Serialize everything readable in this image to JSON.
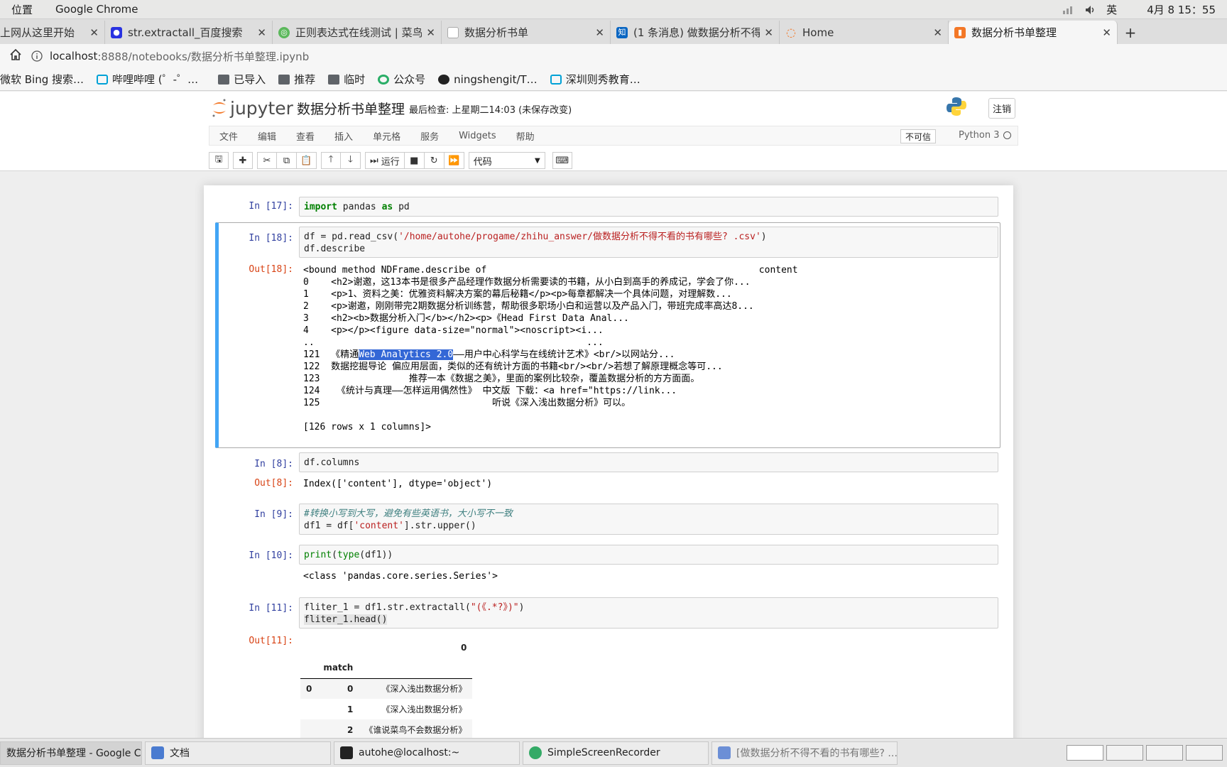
{
  "system": {
    "menu_places": "位置",
    "menu_app": "Google Chrome",
    "ime": "英",
    "clock": "4月 8 15：55"
  },
  "tabs": [
    {
      "title": "上网从这里开始"
    },
    {
      "title": "str.extractall_百度搜索"
    },
    {
      "title": "正则表达式在线测试 | 菜鸟"
    },
    {
      "title": "数据分析书单"
    },
    {
      "title": "(1 条消息) 做数据分析不得"
    },
    {
      "title": "Home"
    },
    {
      "title": "数据分析书单整理"
    }
  ],
  "address": {
    "host": "localhost",
    "path": ":8888/notebooks/数据分析书单整理.ipynb"
  },
  "bookmarks": [
    {
      "label": "微软 Bing 搜索…"
    },
    {
      "label": "哔哩哔哩 (゜-゜…"
    },
    {
      "label": "已导入"
    },
    {
      "label": "推荐"
    },
    {
      "label": "临时"
    },
    {
      "label": "公众号"
    },
    {
      "label": "ningshengit/T…"
    },
    {
      "label": "深圳则秀教育…"
    }
  ],
  "jupyter": {
    "logo_text": "jupyter",
    "notebook_name": "数据分析书单整理",
    "checkpoint": "最后检查: 上星期二14:03   (未保存改变)",
    "logout": "注销",
    "menus": [
      "文件",
      "编辑",
      "查看",
      "插入",
      "单元格",
      "服务",
      "Widgets",
      "帮助"
    ],
    "trust": "不可信",
    "kernel": "Python 3",
    "run_label": "运行",
    "cell_type": "代码"
  },
  "cells": {
    "c17": {
      "prompt": "In [17]:"
    },
    "c18": {
      "prompt": "In [18]:",
      "out_prompt": "Out[18]:",
      "out_lines": [
        "<bound method NDFrame.describe of                                                 content",
        "0    <h2>谢邀，这13本书是很多产品经理作数据分析需要读的书籍，从小白到高手的养成记，学会了你...",
        "1    <p>1、资料之美：优雅资料解决方案的幕后秘籍</p><p>每章都解决一个具体问题，对理解数...",
        "2    <p>谢邀，刚刚带完2期数据分析训练营，帮助很多职场小白和运营以及产品入门，带班完成率高达8...",
        "3    <h2><b>数据分析入门</b></h2><p>《Head First Data Anal...",
        "4    <p></p><figure data-size=\"normal\"><noscript><i...",
        "..                                                 ..."
      ],
      "line121_pre": "121  《精通",
      "line121_hl": "Web Analytics 2.0",
      "line121_post": "——用户中心科学与在线统计艺术》<br/>以网站分...",
      "out_lines2": [
        "122  数据挖掘导论 偏应用层面，类似的还有统计方面的书籍<br/><br/>若想了解原理概念等可...",
        "123                推荐一本《数据之美》，里面的案例比较杂，覆盖数据分析的方方面面。",
        "124   《统计与真理——怎样运用偶然性》 中文版 下载：<a href=\"https://link...",
        "125                               听说《深入浅出数据分析》可以。",
        "",
        "[126 rows x 1 columns]>"
      ]
    },
    "c8": {
      "prompt": "In [8]:",
      "code": "df.columns",
      "out_prompt": "Out[8]:",
      "out": "Index(['content'], dtype='object')"
    },
    "c9": {
      "prompt": "In [9]:",
      "comment": "#转换小写到大写，避免有些英语书，大小写不一致"
    },
    "c10": {
      "prompt": "In [10]:",
      "out": "<class 'pandas.core.series.Series'>"
    },
    "c11": {
      "prompt": "In [11]:",
      "code2": "fliter_1.head()",
      "out_prompt": "Out[11]:",
      "table": {
        "col": "0",
        "index_name": "match",
        "rows": [
          {
            "lvl0": "0",
            "lvl1": "0",
            "val": "《深入浅出数据分析》"
          },
          {
            "lvl0": "",
            "lvl1": "1",
            "val": "《深入浅出数据分析》"
          },
          {
            "lvl0": "",
            "lvl1": "2",
            "val": "《谁说菜鸟不会数据分析》"
          }
        ]
      }
    }
  },
  "taskbar": [
    {
      "label": "数据分析书单整理 - Google Chrome"
    },
    {
      "label": "文档"
    },
    {
      "label": "autohe@localhost:~"
    },
    {
      "label": "SimpleScreenRecorder"
    },
    {
      "label": "[做数据分析不得不看的书有哪些? .…"
    }
  ],
  "colors": {
    "accent_selected_cell": "#42a5f5",
    "in_prompt": "#303f9f",
    "out_prompt": "#d84315",
    "keyword": "#008000",
    "string": "#ba2121"
  }
}
